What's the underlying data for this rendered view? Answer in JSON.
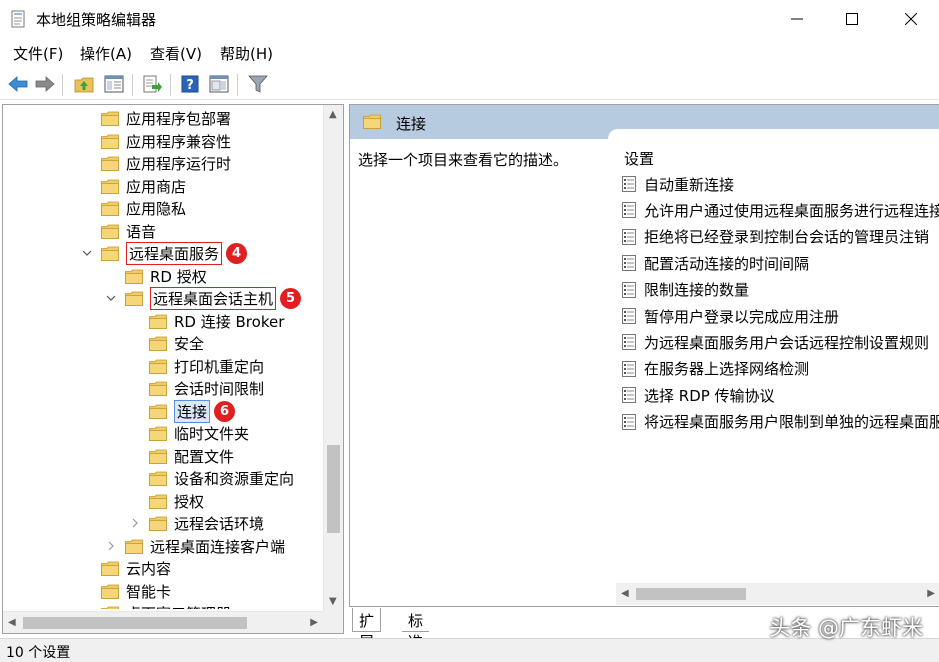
{
  "window": {
    "title": "本地组策略编辑器"
  },
  "menu": [
    "文件(F)",
    "操作(A)",
    "查看(V)",
    "帮助(H)"
  ],
  "toolbar": {
    "icons": [
      "back-arrow-icon",
      "forward-arrow-icon",
      "up-folder-icon",
      "show-hide-tree-icon",
      "export-list-icon",
      "help-icon",
      "properties-icon",
      "filter-icon"
    ]
  },
  "tree": {
    "items": [
      {
        "label": "应用程序包部署"
      },
      {
        "label": "应用程序兼容性"
      },
      {
        "label": "应用程序运行时"
      },
      {
        "label": "应用商店"
      },
      {
        "label": "应用隐私"
      },
      {
        "label": "语音"
      },
      {
        "label": "远程桌面服务",
        "badge": "4"
      },
      {
        "label": "RD 授权"
      },
      {
        "label": "远程桌面会话主机",
        "badge": "5"
      },
      {
        "label": "RD 连接 Broker"
      },
      {
        "label": "安全"
      },
      {
        "label": "打印机重定向"
      },
      {
        "label": "会话时间限制"
      },
      {
        "label": "连接",
        "badge": "6"
      },
      {
        "label": "临时文件夹"
      },
      {
        "label": "配置文件"
      },
      {
        "label": "设备和资源重定向"
      },
      {
        "label": "授权"
      },
      {
        "label": "远程会话环境"
      },
      {
        "label": "远程桌面连接客户端"
      },
      {
        "label": "云内容"
      },
      {
        "label": "智能卡"
      },
      {
        "label": "桌面窗口管理器"
      }
    ]
  },
  "details": {
    "header": "连接",
    "description": "选择一个项目来查看它的描述。",
    "settings_header": "设置",
    "settings": [
      "自动重新连接",
      "允许用户通过使用远程桌面服务进行远程连接",
      "拒绝将已经登录到控制台会话的管理员注销",
      "配置活动连接的时间间隔",
      "限制连接的数量",
      "暂停用户登录以完成应用注册",
      "为远程桌面服务用户会话远程控制设置规则",
      "在服务器上选择网络检测",
      "选择 RDP 传输协议",
      "将远程桌面服务用户限制到单独的远程桌面服务会话"
    ]
  },
  "tabs": [
    "扩展",
    "标准"
  ],
  "status": {
    "text": "10 个设置"
  },
  "watermark": "头条 @广东虾米",
  "colors": {
    "folder": "#e8c15a",
    "header_bg": "#b7cbe0",
    "highlight_red": "#e02020",
    "selected_bg": "#d9e8fb"
  }
}
